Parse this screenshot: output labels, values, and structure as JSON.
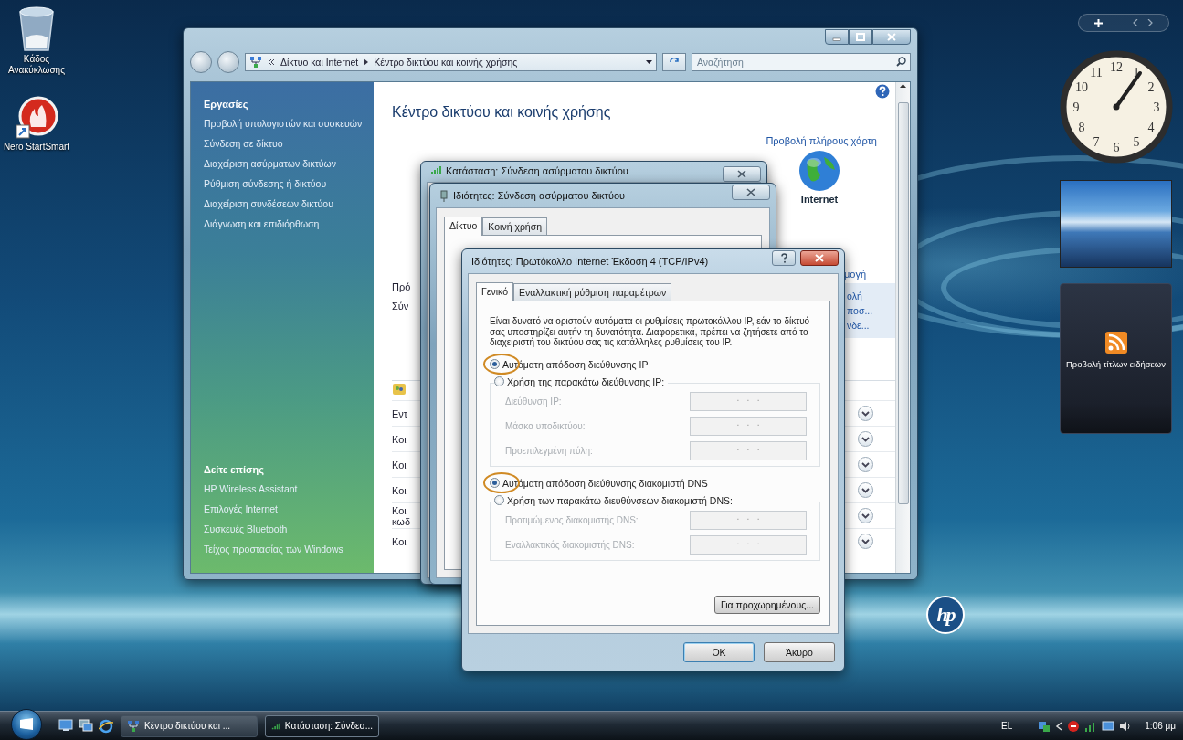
{
  "desktop_icons": [
    {
      "kind": "recycle",
      "label": "Κάδος Ανακύκλωσης"
    },
    {
      "kind": "nero",
      "label": "Nero StartSmart"
    }
  ],
  "explorer": {
    "breadcrumb": [
      "Δίκτυο και Internet",
      "Κέντρο δικτύου και κοινής χρήσης"
    ],
    "search": {
      "placeholder": "Αναζήτηση"
    },
    "tasks": {
      "heading": "Εργασίες",
      "items": [
        "Προβολή υπολογιστών και συσκευών",
        "Σύνδεση σε δίκτυο",
        "Διαχείριση ασύρματων δικτύων",
        "Ρύθμιση σύνδεσης ή δικτύου",
        "Διαχείριση συνδέσεων δικτύου",
        "Διάγνωση και επιδιόρθωση"
      ]
    },
    "see_also": {
      "heading": "Δείτε επίσης",
      "items": [
        "HP Wireless Assistant",
        "Επιλογές Internet",
        "Συσκευές Bluetooth",
        "Τείχος προστασίας των Windows"
      ]
    },
    "title": "Κέντρο δικτύου και κοινής χρήσης",
    "map_link": "Προβολή πλήρους χάρτη",
    "internet_label": "Internet",
    "customize_fragment": "μογή",
    "row_fragments": [
      "Πρό",
      "Σύν"
    ],
    "side_fragments": [
      "ολή",
      "ποσ...",
      "νδε..."
    ],
    "sharing_rows": [
      {
        "label": "Εντ"
      },
      {
        "label": "Κοι"
      },
      {
        "label": "Κοι"
      },
      {
        "label": "Κοι"
      },
      {
        "label": "Κοι",
        "label2": "κωδ"
      },
      {
        "label": "Κοι"
      }
    ]
  },
  "status_dialog": {
    "title": "Κατάσταση: Σύνδεση ασύρματου δικτύου"
  },
  "properties_dialog": {
    "title": "Ιδιότητες: Σύνδεση ασύρματου δικτύου",
    "tabs": [
      {
        "label": "Δίκτυο",
        "selected": true
      },
      {
        "label": "Κοινή χρήση",
        "selected": false
      }
    ]
  },
  "ipv4_dialog": {
    "title": "Ιδιότητες: Πρωτόκολλο Internet Έκδοση 4 (TCP/IPv4)",
    "tabs": [
      {
        "label": "Γενικό",
        "selected": true
      },
      {
        "label": "Εναλλακτική ρύθμιση παραμέτρων",
        "selected": false
      }
    ],
    "description": "Είναι δυνατό να οριστούν αυτόματα οι ρυθμίσεις πρωτοκόλλου IP, εάν το δίκτυό σας υποστηρίζει αυτήν τη δυνατότητα. Διαφορετικά, πρέπει να ζητήσετε από το διαχειριστή του δικτύου σας τις κατάλληλες ρυθμίσεις του IP.",
    "groups": [
      {
        "annotated": true,
        "options": [
          {
            "label": "Αυτόματη απόδοση διεύθυνσης IP",
            "selected": true
          },
          {
            "label": "Χρήση της παρακάτω διεύθυνσης IP:",
            "selected": false
          }
        ],
        "fields": [
          {
            "label": "Διεύθυνση IP:",
            "value": ".   .   .",
            "disabled": true
          },
          {
            "label": "Μάσκα υποδικτύου:",
            "value": ".   .   .",
            "disabled": true
          },
          {
            "label": "Προεπιλεγμένη πύλη:",
            "value": ".   .   .",
            "disabled": true
          }
        ]
      },
      {
        "annotated": true,
        "options": [
          {
            "label": "Αυτόματη απόδοση διεύθυνσης διακομιστή DNS",
            "selected": true
          },
          {
            "label": "Χρήση των παρακάτω διευθύνσεων διακομιστή DNS:",
            "selected": false
          }
        ],
        "fields": [
          {
            "label": "Προτιμώμενος διακομιστής DNS:",
            "value": ".   .   .",
            "disabled": true
          },
          {
            "label": "Εναλλακτικός διακομιστής DNS:",
            "value": ".   .   .",
            "disabled": true
          }
        ]
      }
    ],
    "advanced_button": "Για προχωρημένους...",
    "buttons": [
      {
        "label": "OK",
        "kind": "default"
      },
      {
        "label": "Άκυρο",
        "kind": "normal"
      }
    ]
  },
  "gadgets": {
    "clock_numerals": [
      "12",
      "1",
      "2",
      "3",
      "4",
      "5",
      "6",
      "7",
      "8",
      "9",
      "10",
      "11"
    ],
    "feed_text": "Προβολή τίτλων ειδήσεων"
  },
  "wallpaper_logo": "hp",
  "taskbar": {
    "buttons": [
      {
        "label": "Κέντρο δικτύου και ...",
        "selected": false,
        "kind": "explorer"
      },
      {
        "label": "Κατάσταση: Σύνδεσ...",
        "selected": true,
        "kind": "signal"
      }
    ],
    "language": "EL",
    "time": "1:06 μμ"
  }
}
